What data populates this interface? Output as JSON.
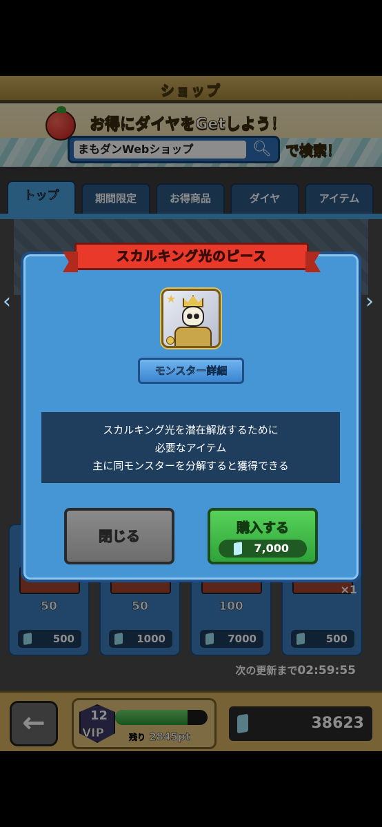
{
  "header": {
    "title": "ショップ"
  },
  "banner": {
    "headline_pre": "お得に",
    "headline_accent": "ダイヤ",
    "headline_post": "をGetしよう！",
    "search_text": "まもダンWebショップ",
    "search_suffix": "で検索！",
    "search_icon": "search-icon"
  },
  "tabs": [
    {
      "label": "トップ",
      "active": true
    },
    {
      "label": "期間限定"
    },
    {
      "label": "お得商品"
    },
    {
      "label": "ダイヤ"
    },
    {
      "label": "アイテム"
    }
  ],
  "cards": [
    {
      "qty": "50",
      "price": "500"
    },
    {
      "qty": "50",
      "price": "1000"
    },
    {
      "qty": "100",
      "price": "7000"
    },
    {
      "qty": "×1",
      "price": "500"
    }
  ],
  "timer": {
    "prefix": "次の更新まで",
    "value": "02:59:55"
  },
  "bottom": {
    "back_icon": "back-arrow-icon",
    "vip_level": "12",
    "vip_label": "VIP",
    "vip_progress": 0.78,
    "remain_prefix": "残り",
    "remain_value": "2845pt",
    "gem_count": "38623"
  },
  "modal": {
    "title": "スカルキング光のピース",
    "detail_button": "モンスター詳細",
    "description": [
      "スカルキング光を潜在解放するために",
      "必要なアイテム",
      "主に同モンスターを分解すると獲得できる"
    ],
    "close_button": "閉じる",
    "buy_button": "購入する",
    "buy_cost": "7,000"
  },
  "colors": {
    "modal_bg": "#4696d6",
    "ribbon": "#e8392a",
    "buy_green": "#2ea33a",
    "tab_active": "#4aa3e0"
  }
}
